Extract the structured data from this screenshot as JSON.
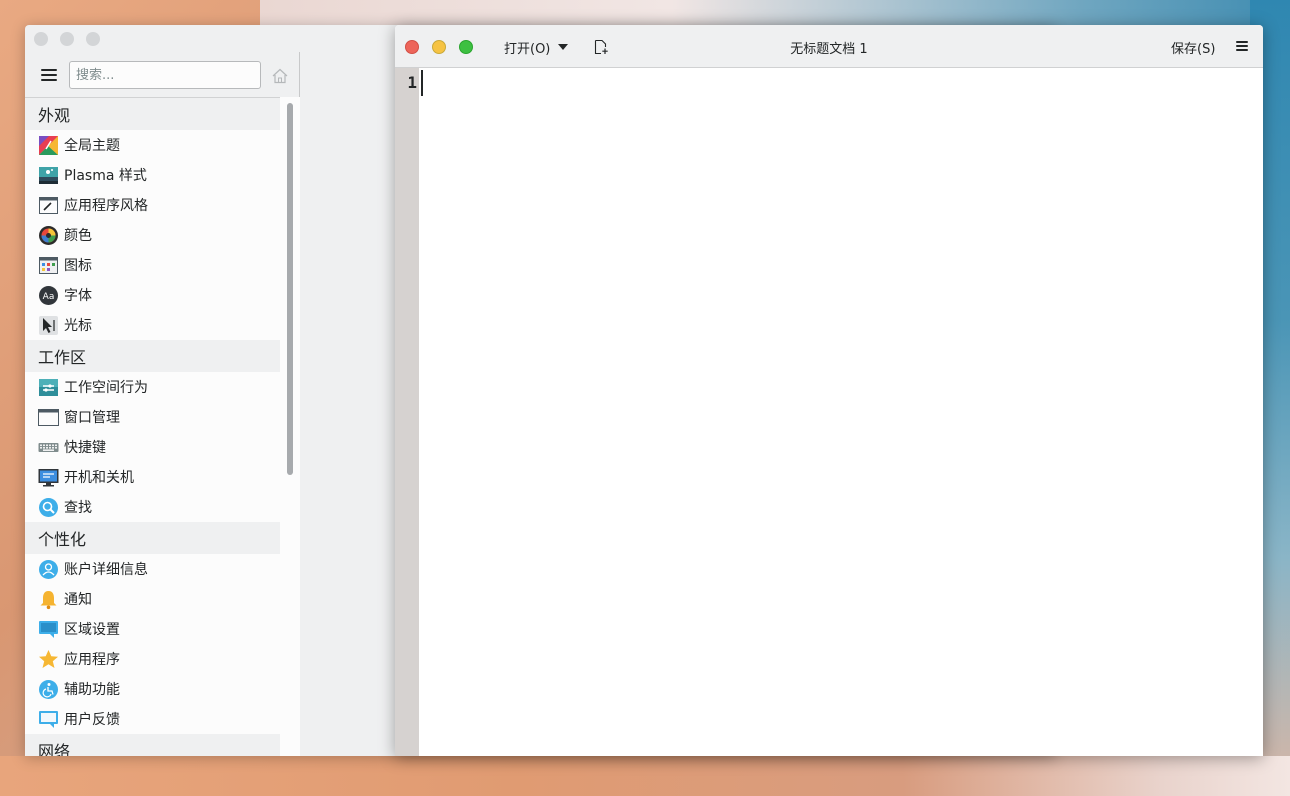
{
  "settings": {
    "search_placeholder": "搜索...",
    "categories": [
      {
        "title": "外观",
        "items": [
          {
            "label": "全局主题",
            "icon": "global-theme-icon"
          },
          {
            "label": "Plasma 样式",
            "icon": "plasma-style-icon"
          },
          {
            "label": "应用程序风格",
            "icon": "app-style-icon"
          },
          {
            "label": "颜色",
            "icon": "colors-icon"
          },
          {
            "label": "图标",
            "icon": "icons-icon"
          },
          {
            "label": "字体",
            "icon": "fonts-icon"
          },
          {
            "label": "光标",
            "icon": "cursor-icon"
          }
        ]
      },
      {
        "title": "工作区",
        "items": [
          {
            "label": "工作空间行为",
            "icon": "workspace-behavior-icon"
          },
          {
            "label": "窗口管理",
            "icon": "window-management-icon"
          },
          {
            "label": "快捷键",
            "icon": "keyboard-icon"
          },
          {
            "label": "开机和关机",
            "icon": "startup-shutdown-icon"
          },
          {
            "label": "查找",
            "icon": "search-icon"
          }
        ]
      },
      {
        "title": "个性化",
        "items": [
          {
            "label": "账户详细信息",
            "icon": "user-account-icon"
          },
          {
            "label": "通知",
            "icon": "bell-icon"
          },
          {
            "label": "区域设置",
            "icon": "region-icon"
          },
          {
            "label": "应用程序",
            "icon": "star-icon"
          },
          {
            "label": "辅助功能",
            "icon": "accessibility-icon"
          },
          {
            "label": "用户反馈",
            "icon": "feedback-icon"
          }
        ]
      },
      {
        "title": "网络",
        "items": []
      }
    ]
  },
  "editor": {
    "open_label": "打开(O)",
    "title": "无标题文档 1",
    "save_label": "保存(S)",
    "line_number": "1"
  },
  "colors": {
    "close": "#ed655a",
    "minimize": "#f6c343",
    "maximize": "#3dc041",
    "gutter": "#d6d2d0",
    "window_bg": "#eff0f1"
  }
}
